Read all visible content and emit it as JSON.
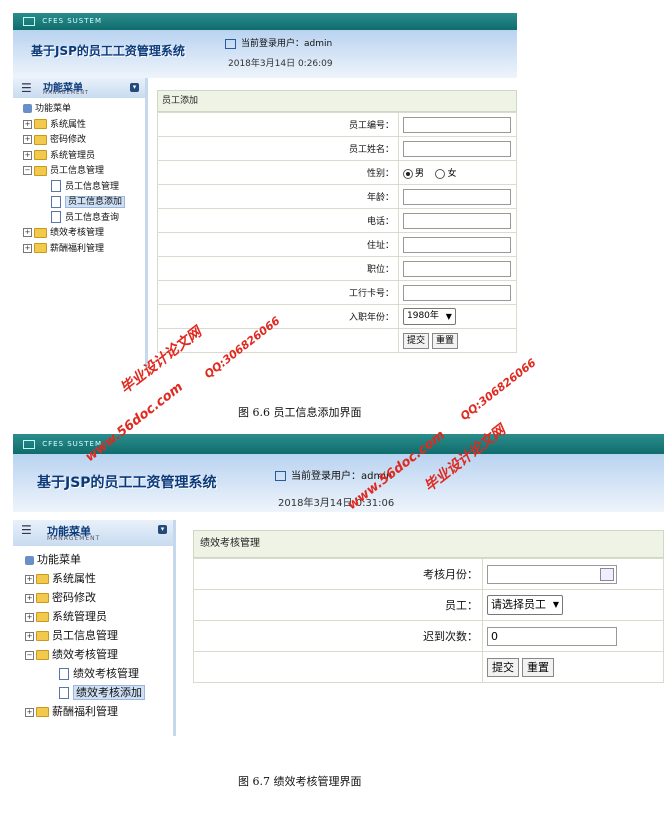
{
  "figure1": {
    "topbar_text": "CFES SUSTEM",
    "system_name": "基于JSP的员工工资管理系统",
    "current_user": "当前登录用户：admin",
    "datetime": "2018年3月14日  0:26:09",
    "menu_title": "功能菜单",
    "menu_subtitle": "MANAGEMENT",
    "tree": {
      "root": "功能菜单",
      "items": [
        "系统属性",
        "密码修改",
        "系统管理员",
        "员工信息管理"
      ],
      "sub_items": [
        "员工信息管理",
        "员工信息添加",
        "员工信息查询"
      ],
      "after": [
        "绩效考核管理",
        "薪酬福利管理"
      ]
    },
    "form_title": "员工添加",
    "labels": {
      "emp_no": "员工编号：",
      "emp_name": "员工姓名：",
      "gender": "性别：",
      "age": "年龄：",
      "phone": "电话：",
      "address": "住址：",
      "position": "职位：",
      "bank_card": "工行卡号：",
      "entry_year": "入职年份："
    },
    "gender_options": {
      "male": "男",
      "female": "女",
      "selected": "男"
    },
    "entry_year_value": "1980年",
    "submit": "提交",
    "reset": "重置",
    "caption": "图 6.6  员工信息添加界面"
  },
  "figure2": {
    "topbar_text": "CFES SUSTEM",
    "system_name": "基于JSP的员工工资管理系统",
    "current_user": "当前登录用户：admin",
    "datetime": "2018年3月14日  0:31:06",
    "menu_title": "功能菜单",
    "menu_subtitle": "MANAGEMENT",
    "tree": {
      "root": "功能菜单",
      "items": [
        "系统属性",
        "密码修改",
        "系统管理员",
        "员工信息管理",
        "绩效考核管理"
      ],
      "sub_items": [
        "绩效考核管理",
        "绩效考核添加"
      ],
      "after": [
        "薪酬福利管理"
      ]
    },
    "form_title": "绩效考核管理",
    "labels": {
      "month": "考核月份：",
      "employee": "员工：",
      "late_count": "迟到次数："
    },
    "employee_select": "请选择员工",
    "late_count_value": "0",
    "submit": "提交",
    "reset": "重置",
    "caption": "图 6.7  绩效考核管理界面"
  },
  "watermarks": {
    "site": "www.56doc.com",
    "name": "毕业设计论文网",
    "qq": "QQ:306826066"
  }
}
